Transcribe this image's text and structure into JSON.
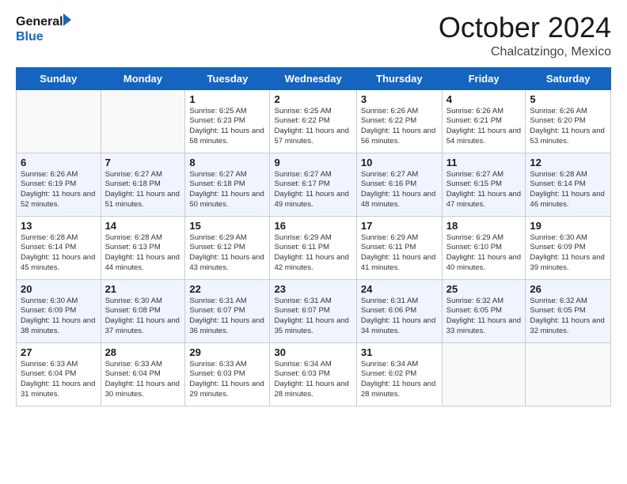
{
  "logo": {
    "line1": "General",
    "line2": "Blue"
  },
  "title": "October 2024",
  "location": "Chalcatzingo, Mexico",
  "weekdays": [
    "Sunday",
    "Monday",
    "Tuesday",
    "Wednesday",
    "Thursday",
    "Friday",
    "Saturday"
  ],
  "weeks": [
    [
      null,
      null,
      {
        "day": "1",
        "sunrise": "6:25 AM",
        "sunset": "6:23 PM",
        "daylight": "11 hours and 58 minutes."
      },
      {
        "day": "2",
        "sunrise": "6:25 AM",
        "sunset": "6:22 PM",
        "daylight": "11 hours and 57 minutes."
      },
      {
        "day": "3",
        "sunrise": "6:26 AM",
        "sunset": "6:22 PM",
        "daylight": "11 hours and 56 minutes."
      },
      {
        "day": "4",
        "sunrise": "6:26 AM",
        "sunset": "6:21 PM",
        "daylight": "11 hours and 54 minutes."
      },
      {
        "day": "5",
        "sunrise": "6:26 AM",
        "sunset": "6:20 PM",
        "daylight": "11 hours and 53 minutes."
      }
    ],
    [
      {
        "day": "6",
        "sunrise": "6:26 AM",
        "sunset": "6:19 PM",
        "daylight": "11 hours and 52 minutes."
      },
      {
        "day": "7",
        "sunrise": "6:27 AM",
        "sunset": "6:18 PM",
        "daylight": "11 hours and 51 minutes."
      },
      {
        "day": "8",
        "sunrise": "6:27 AM",
        "sunset": "6:18 PM",
        "daylight": "11 hours and 50 minutes."
      },
      {
        "day": "9",
        "sunrise": "6:27 AM",
        "sunset": "6:17 PM",
        "daylight": "11 hours and 49 minutes."
      },
      {
        "day": "10",
        "sunrise": "6:27 AM",
        "sunset": "6:16 PM",
        "daylight": "11 hours and 48 minutes."
      },
      {
        "day": "11",
        "sunrise": "6:27 AM",
        "sunset": "6:15 PM",
        "daylight": "11 hours and 47 minutes."
      },
      {
        "day": "12",
        "sunrise": "6:28 AM",
        "sunset": "6:14 PM",
        "daylight": "11 hours and 46 minutes."
      }
    ],
    [
      {
        "day": "13",
        "sunrise": "6:28 AM",
        "sunset": "6:14 PM",
        "daylight": "11 hours and 45 minutes."
      },
      {
        "day": "14",
        "sunrise": "6:28 AM",
        "sunset": "6:13 PM",
        "daylight": "11 hours and 44 minutes."
      },
      {
        "day": "15",
        "sunrise": "6:29 AM",
        "sunset": "6:12 PM",
        "daylight": "11 hours and 43 minutes."
      },
      {
        "day": "16",
        "sunrise": "6:29 AM",
        "sunset": "6:11 PM",
        "daylight": "11 hours and 42 minutes."
      },
      {
        "day": "17",
        "sunrise": "6:29 AM",
        "sunset": "6:11 PM",
        "daylight": "11 hours and 41 minutes."
      },
      {
        "day": "18",
        "sunrise": "6:29 AM",
        "sunset": "6:10 PM",
        "daylight": "11 hours and 40 minutes."
      },
      {
        "day": "19",
        "sunrise": "6:30 AM",
        "sunset": "6:09 PM",
        "daylight": "11 hours and 39 minutes."
      }
    ],
    [
      {
        "day": "20",
        "sunrise": "6:30 AM",
        "sunset": "6:09 PM",
        "daylight": "11 hours and 38 minutes."
      },
      {
        "day": "21",
        "sunrise": "6:30 AM",
        "sunset": "6:08 PM",
        "daylight": "11 hours and 37 minutes."
      },
      {
        "day": "22",
        "sunrise": "6:31 AM",
        "sunset": "6:07 PM",
        "daylight": "11 hours and 36 minutes."
      },
      {
        "day": "23",
        "sunrise": "6:31 AM",
        "sunset": "6:07 PM",
        "daylight": "11 hours and 35 minutes."
      },
      {
        "day": "24",
        "sunrise": "6:31 AM",
        "sunset": "6:06 PM",
        "daylight": "11 hours and 34 minutes."
      },
      {
        "day": "25",
        "sunrise": "6:32 AM",
        "sunset": "6:05 PM",
        "daylight": "11 hours and 33 minutes."
      },
      {
        "day": "26",
        "sunrise": "6:32 AM",
        "sunset": "6:05 PM",
        "daylight": "11 hours and 32 minutes."
      }
    ],
    [
      {
        "day": "27",
        "sunrise": "6:33 AM",
        "sunset": "6:04 PM",
        "daylight": "11 hours and 31 minutes."
      },
      {
        "day": "28",
        "sunrise": "6:33 AM",
        "sunset": "6:04 PM",
        "daylight": "11 hours and 30 minutes."
      },
      {
        "day": "29",
        "sunrise": "6:33 AM",
        "sunset": "6:03 PM",
        "daylight": "11 hours and 29 minutes."
      },
      {
        "day": "30",
        "sunrise": "6:34 AM",
        "sunset": "6:03 PM",
        "daylight": "11 hours and 28 minutes."
      },
      {
        "day": "31",
        "sunrise": "6:34 AM",
        "sunset": "6:02 PM",
        "daylight": "11 hours and 28 minutes."
      },
      null,
      null
    ]
  ]
}
